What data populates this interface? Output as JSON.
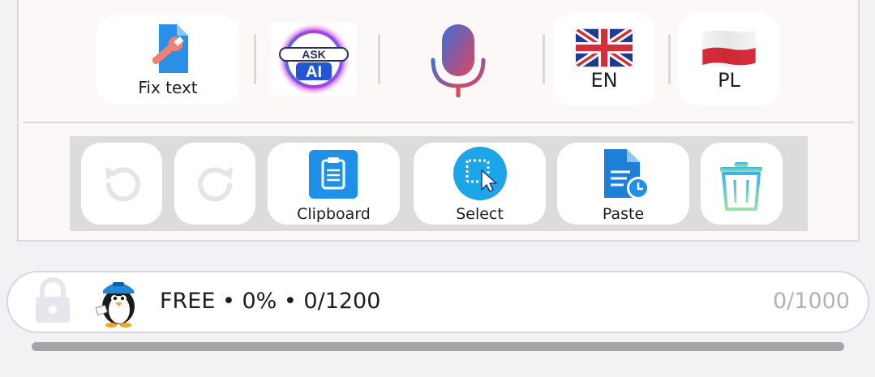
{
  "toolbar": {
    "fix_text": {
      "label": "Fix text",
      "icon": "wrench-document-icon"
    },
    "ask_ai": {
      "line1": "ASK",
      "line2": "AI",
      "icon": "ask-ai-icon"
    },
    "voice": {
      "icon": "microphone-icon"
    },
    "lang_source": {
      "label": "EN",
      "icon": "uk-flag-icon"
    },
    "lang_target": {
      "label": "PL",
      "icon": "poland-flag-icon"
    }
  },
  "edit_bar": {
    "undo": {
      "icon": "undo-icon",
      "enabled": false
    },
    "redo": {
      "icon": "redo-icon",
      "enabled": false
    },
    "clipboard": {
      "label": "Clipboard",
      "icon": "clipboard-icon"
    },
    "select": {
      "label": "Select",
      "icon": "select-cursor-icon"
    },
    "paste": {
      "label": "Paste",
      "icon": "paste-clock-icon"
    },
    "clear": {
      "icon": "trash-icon"
    }
  },
  "status": {
    "locked": true,
    "plan_text": "FREE • 0% • 0/1200",
    "counter": "0/1000",
    "avatar": "penguin-avatar"
  },
  "colors": {
    "accent_blue": "#1e90e8",
    "mic_gradient_start": "#3b6fd8",
    "mic_gradient_end": "#e0455e",
    "disabled_gray": "#e3e5ea"
  }
}
